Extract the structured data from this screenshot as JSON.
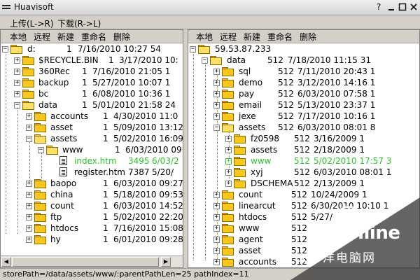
{
  "window": {
    "title": "Huavisoft",
    "help_label": "?"
  },
  "menu": {
    "upload": "上传(L->R)",
    "download": "下载(R->L)"
  },
  "left": {
    "toolbar": [
      "本地",
      "远程",
      "新建",
      "重命名",
      "删除"
    ],
    "rows": [
      {
        "label": "d:",
        "size": "1",
        "date": "7/16/2010 10:27 54"
      },
      {
        "label": "$RECYCLE.BIN",
        "size": "1",
        "date": "3/17/2010 10:"
      },
      {
        "label": "360Rec",
        "size": "1",
        "date": "7/16/2010 21:05 1"
      },
      {
        "label": "backup",
        "size": "1",
        "date": "5/27/2010 10:07 1"
      },
      {
        "label": "bc",
        "size": "1",
        "date": "6/08/2010 10:36 1"
      },
      {
        "label": "data",
        "size": "1",
        "date": "5/01/2010 21:58 24"
      },
      {
        "label": "accounts",
        "size": "1",
        "date": "4/30/2010 11:0"
      },
      {
        "label": "asset",
        "size": "1",
        "date": "5/09/2010 13:12"
      },
      {
        "label": "assets",
        "size": "1",
        "date": "5/02/2010 16:09"
      },
      {
        "label": "www",
        "size": "1",
        "date": "6/03/2010 09:"
      },
      {
        "label": "index.htm",
        "size": "3495",
        "date": "6/03/2"
      },
      {
        "label": "register.htm",
        "size": "7387",
        "date": "5/20/"
      },
      {
        "label": "baopo",
        "size": "1",
        "date": "6/03/2010 09:27"
      },
      {
        "label": "china",
        "size": "1",
        "date": "5/18/2010 09:53"
      },
      {
        "label": "count",
        "size": "1",
        "date": "6/03/2010 14:52"
      },
      {
        "label": "ftp",
        "size": "1",
        "date": "5/02/2010 22:20 2"
      },
      {
        "label": "htdocs",
        "size": "1",
        "date": "7/16/2010 15:08"
      },
      {
        "label": "hy",
        "size": "1",
        "date": "6/01/2010 09:28 1"
      }
    ]
  },
  "right": {
    "toolbar": [
      "本地",
      "远程",
      "新建",
      "重命名",
      "删除"
    ],
    "rows": [
      {
        "label": "59.53.87.233",
        "size": "",
        "date": ""
      },
      {
        "label": "data",
        "size": "512",
        "date": "7/18/2010 11:15 31"
      },
      {
        "label": "sql",
        "size": "512",
        "date": "7/11/2010 20:43 1"
      },
      {
        "label": "demo",
        "size": "512",
        "date": "3/12/2010 14:16 1"
      },
      {
        "label": "pay",
        "size": "512",
        "date": "6/03/2010 07:58 1"
      },
      {
        "label": "email",
        "size": "512",
        "date": "5/13/2010 23:37 1"
      },
      {
        "label": "jexe",
        "size": "512",
        "date": "7/17/2010 10:16 1"
      },
      {
        "label": "assets",
        "size": "512",
        "date": "6/03/2010 08:01 8"
      },
      {
        "label": "fz0598",
        "size": "512",
        "date": "3/16/2009     1"
      },
      {
        "label": "assets",
        "size": "512",
        "date": "2/18/2009     1"
      },
      {
        "label": "www",
        "size": "512",
        "date": "5/02/2010 17:57 3"
      },
      {
        "label": "xyj",
        "size": "512",
        "date": "6/03/2010 08:01 1"
      },
      {
        "label": "DSCHEMA",
        "size": "512",
        "date": "2/13/2009     1"
      },
      {
        "label": "count",
        "size": "512",
        "date": "10/24/2009     1"
      },
      {
        "label": "linearcut",
        "size": "512",
        "date": "6/30/2010 10:10 1"
      },
      {
        "label": "htdocs",
        "size": "512",
        "date": "5/27/"
      },
      {
        "label": "www",
        "size": "512",
        "date": ""
      },
      {
        "label": "agent",
        "size": "512",
        "date": ""
      },
      {
        "label": "asset",
        "size": "512",
        "date": ""
      },
      {
        "label": "accounts",
        "size": "512",
        "date": ""
      }
    ]
  },
  "status": "storePath=/data/assets/www/:parentPathLen=25 pathIndex=11",
  "watermark": {
    "brand": "PConline",
    "sub": "太平洋电脑网"
  }
}
